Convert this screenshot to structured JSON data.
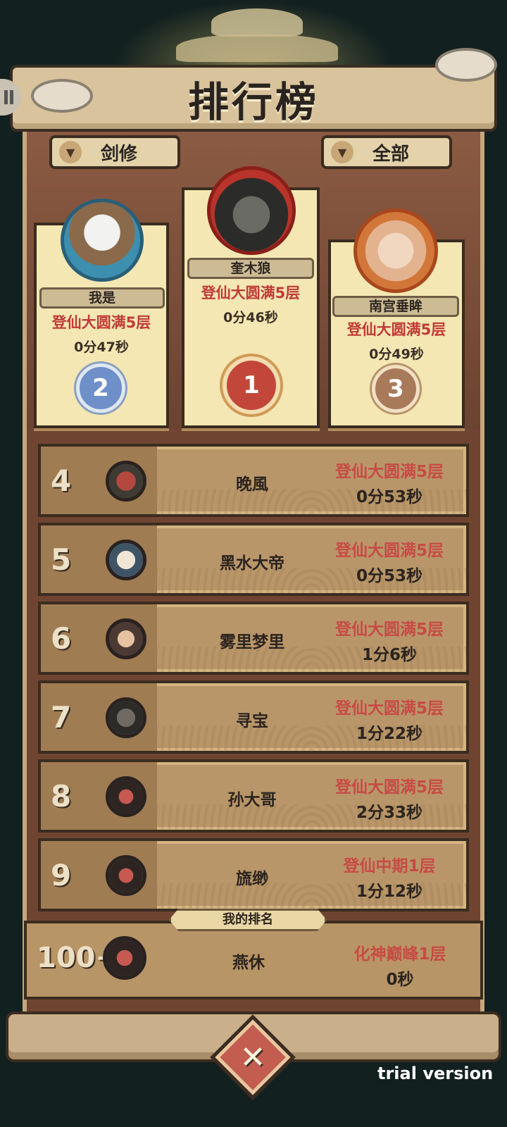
{
  "header": {
    "title": "排行榜"
  },
  "filters": [
    {
      "label": "剑修",
      "icon": "chevron-down-icon"
    },
    {
      "label": "全部",
      "icon": "chevron-down-icon"
    }
  ],
  "podium": [
    {
      "rank": "1",
      "name": "奎木狼",
      "realm": "登仙大圆满5层",
      "time": "0分46秒",
      "medal_color": "#c2473a"
    },
    {
      "rank": "2",
      "name": "我是",
      "realm": "登仙大圆满5层",
      "time": "0分47秒",
      "medal_color": "#6f8fc8"
    },
    {
      "rank": "3",
      "name": "南宫垂眸",
      "realm": "登仙大圆满5层",
      "time": "0分49秒",
      "medal_color": "#a97a5a"
    }
  ],
  "rows": [
    {
      "rank": "4",
      "name": "晚風",
      "realm": "登仙大圆满5层",
      "time": "0分53秒"
    },
    {
      "rank": "5",
      "name": "黑水大帝",
      "realm": "登仙大圆满5层",
      "time": "0分53秒"
    },
    {
      "rank": "6",
      "name": "雾里梦里",
      "realm": "登仙大圆满5层",
      "time": "1分6秒"
    },
    {
      "rank": "7",
      "name": "寻宝",
      "realm": "登仙大圆满5层",
      "time": "1分22秒"
    },
    {
      "rank": "8",
      "name": "孙大哥",
      "realm": "登仙大圆满5层",
      "time": "2分33秒"
    },
    {
      "rank": "9",
      "name": "旒缈",
      "realm": "登仙中期1层",
      "time": "1分12秒"
    }
  ],
  "my_rank": {
    "label": "我的排名",
    "rank": "100+",
    "name": "燕休",
    "realm": "化神巅峰1层",
    "time": "0秒"
  },
  "watermark": "trial version",
  "colors": {
    "realm_red": "#c13a38",
    "card_bg": "#f4e7b3",
    "panel_brown": "#6f4531"
  }
}
